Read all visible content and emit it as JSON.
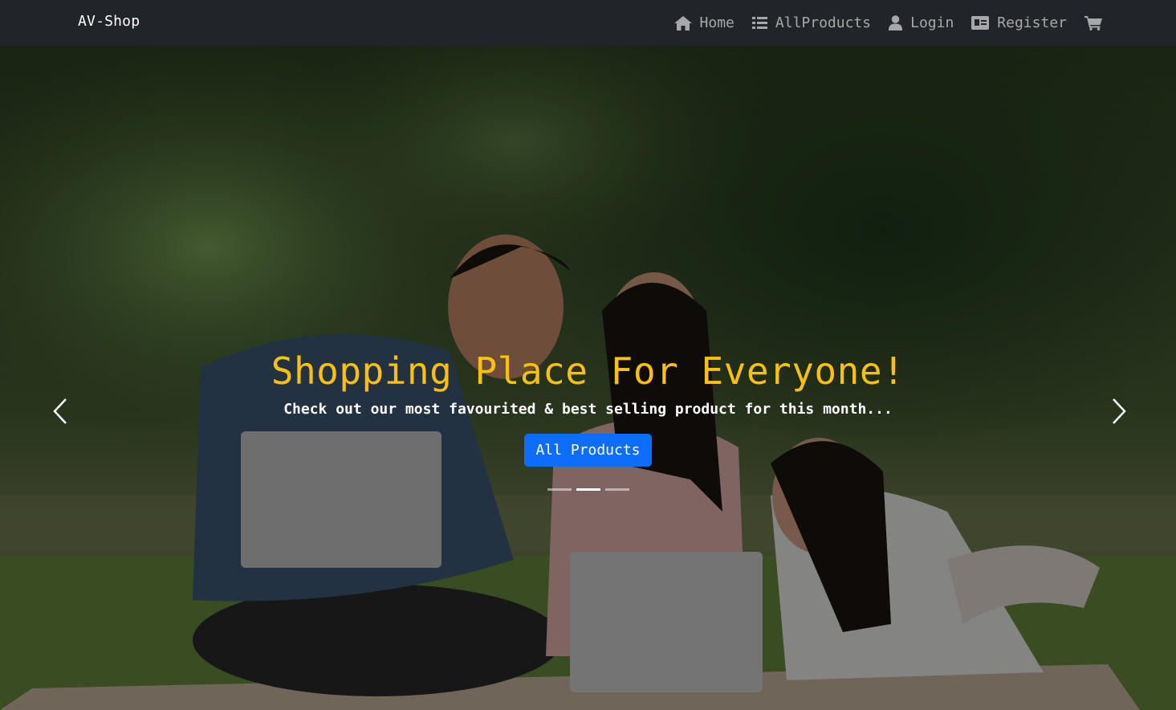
{
  "navbar": {
    "brand": "AV-Shop",
    "items": [
      {
        "label": "Home",
        "icon": "home-icon"
      },
      {
        "label": "AllProducts",
        "icon": "list-icon"
      },
      {
        "label": "Login",
        "icon": "user-icon"
      },
      {
        "label": "Register",
        "icon": "id-card-icon"
      }
    ],
    "cart_icon": "cart-icon"
  },
  "hero": {
    "title": "Shopping Place For Everyone!",
    "subtitle": "Check out our most favourited & best selling product for this month...",
    "cta_label": "All Products",
    "slides_count": 3,
    "active_slide": 2
  },
  "colors": {
    "navbar_bg": "#212529",
    "title": "#ffc107",
    "button": "#0d6efd"
  }
}
